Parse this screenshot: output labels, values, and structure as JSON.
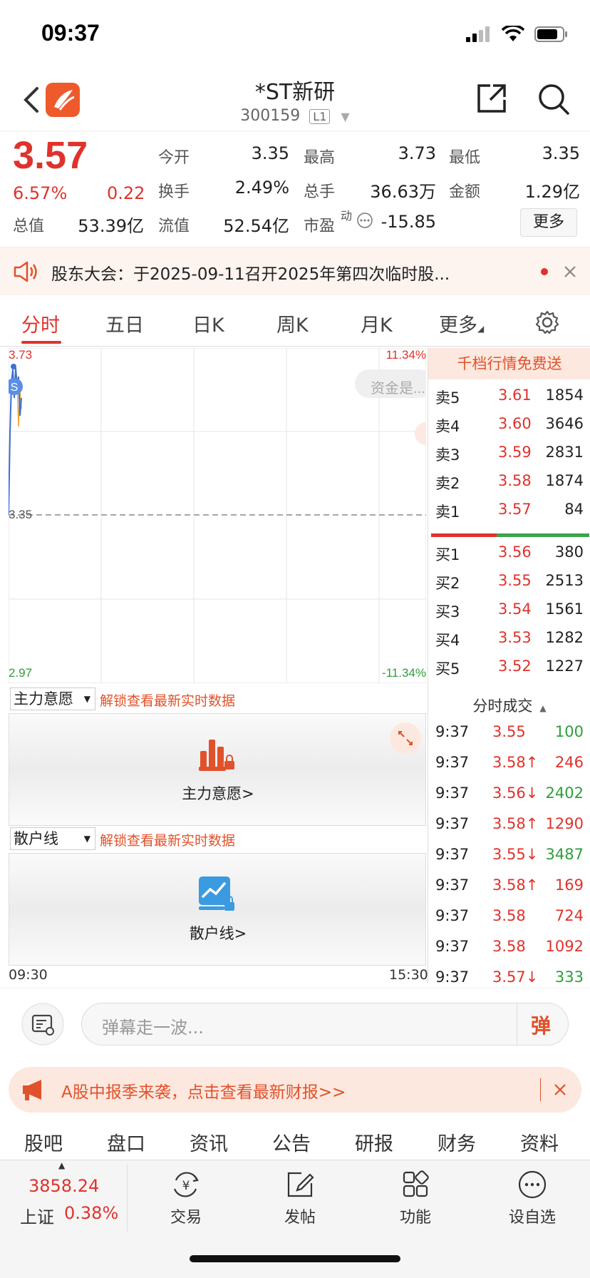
{
  "status_bar": {
    "time": "09:37"
  },
  "header": {
    "title": "*ST新研",
    "code": "300159",
    "level": "L1"
  },
  "quote": {
    "price": "3.57",
    "change_pct": "6.57%",
    "change_abs": "0.22",
    "fields": [
      {
        "label": "今开",
        "value": "3.35",
        "color": "#222"
      },
      {
        "label": "最高",
        "value": "3.73",
        "color": "#e0322b"
      },
      {
        "label": "最低",
        "value": "3.35",
        "color": "#222"
      },
      {
        "label": "换手",
        "value": "2.49%",
        "color": "#222"
      },
      {
        "label": "总手",
        "value": "36.63万",
        "color": "#222"
      },
      {
        "label": "金额",
        "value": "1.29亿",
        "color": "#222"
      },
      {
        "label": "总值",
        "value": "53.39亿",
        "color": "#222"
      },
      {
        "label": "流值",
        "value": "52.54亿",
        "color": "#222"
      },
      {
        "label": "市盈",
        "value": "-15.85",
        "color": "#222"
      }
    ],
    "pe_superscript": "动",
    "more_label": "更多"
  },
  "announcement": {
    "text": "股东大会：于2025-09-11召开2025年第四次临时股..."
  },
  "tabs": [
    "分时",
    "五日",
    "日K",
    "周K",
    "月K",
    "更多"
  ],
  "chart": {
    "top_price": "3.73",
    "mid_price": "3.35",
    "bottom_price": "2.97",
    "top_pct": "11.34%",
    "bottom_pct": "-11.34%",
    "start_time": "09:30",
    "end_time": "15:30",
    "marker": "S",
    "overlay_text": "资金是..."
  },
  "orderbook": {
    "promo": "千档行情免费送",
    "asks": [
      {
        "label": "卖5",
        "price": "3.61",
        "vol": "1854"
      },
      {
        "label": "卖4",
        "price": "3.60",
        "vol": "3646"
      },
      {
        "label": "卖3",
        "price": "3.59",
        "vol": "2831"
      },
      {
        "label": "卖2",
        "price": "3.58",
        "vol": "1874"
      },
      {
        "label": "卖1",
        "price": "3.57",
        "vol": "84"
      }
    ],
    "bids": [
      {
        "label": "买1",
        "price": "3.56",
        "vol": "380"
      },
      {
        "label": "买2",
        "price": "3.55",
        "vol": "2513"
      },
      {
        "label": "买3",
        "price": "3.54",
        "vol": "1561"
      },
      {
        "label": "买4",
        "price": "3.53",
        "vol": "1282"
      },
      {
        "label": "买5",
        "price": "3.52",
        "vol": "1227"
      }
    ],
    "trades_title": "分时成交",
    "trades": [
      {
        "time": "9:37",
        "price": "3.55",
        "vol": "100",
        "arrow": "",
        "vol_color": "#2e9e3a"
      },
      {
        "time": "9:37",
        "price": "3.58↑",
        "vol": "246",
        "arrow": "",
        "vol_color": "#e0322b"
      },
      {
        "time": "9:37",
        "price": "3.56↓",
        "vol": "2402",
        "arrow": "",
        "vol_color": "#2e9e3a"
      },
      {
        "time": "9:37",
        "price": "3.58↑",
        "vol": "1290",
        "arrow": "",
        "vol_color": "#e0322b"
      },
      {
        "time": "9:37",
        "price": "3.55↓",
        "vol": "3487",
        "arrow": "",
        "vol_color": "#2e9e3a"
      },
      {
        "time": "9:37",
        "price": "3.58↑",
        "vol": "169",
        "arrow": "",
        "vol_color": "#e0322b"
      },
      {
        "time": "9:37",
        "price": "3.58",
        "vol": "724",
        "arrow": "",
        "vol_color": "#e0322b"
      },
      {
        "time": "9:37",
        "price": "3.58",
        "vol": "1092",
        "arrow": "",
        "vol_color": "#e0322b"
      },
      {
        "time": "9:37",
        "price": "3.57↓",
        "vol": "333",
        "arrow": "",
        "vol_color": "#2e9e3a"
      }
    ]
  },
  "indicators": [
    {
      "select": "主力意愿",
      "hint": "解锁查看最新实时数据",
      "label": "主力意愿>"
    },
    {
      "select": "散户线",
      "hint": "解锁查看最新实时数据",
      "label": "散户线>"
    }
  ],
  "comment": {
    "placeholder": "弹幕走一波...",
    "send_label": "弹"
  },
  "promo_banner": {
    "text": "A股中报季来袭，点击查看最新财报>>"
  },
  "section_tabs": [
    "股吧",
    "盘口",
    "资讯",
    "公告",
    "研报",
    "财务",
    "资料"
  ],
  "bottom_nav": {
    "index_value": "3858.24",
    "index_name": "上证",
    "index_pct": "0.38%",
    "items": [
      "交易",
      "发帖",
      "功能",
      "设自选"
    ]
  }
}
